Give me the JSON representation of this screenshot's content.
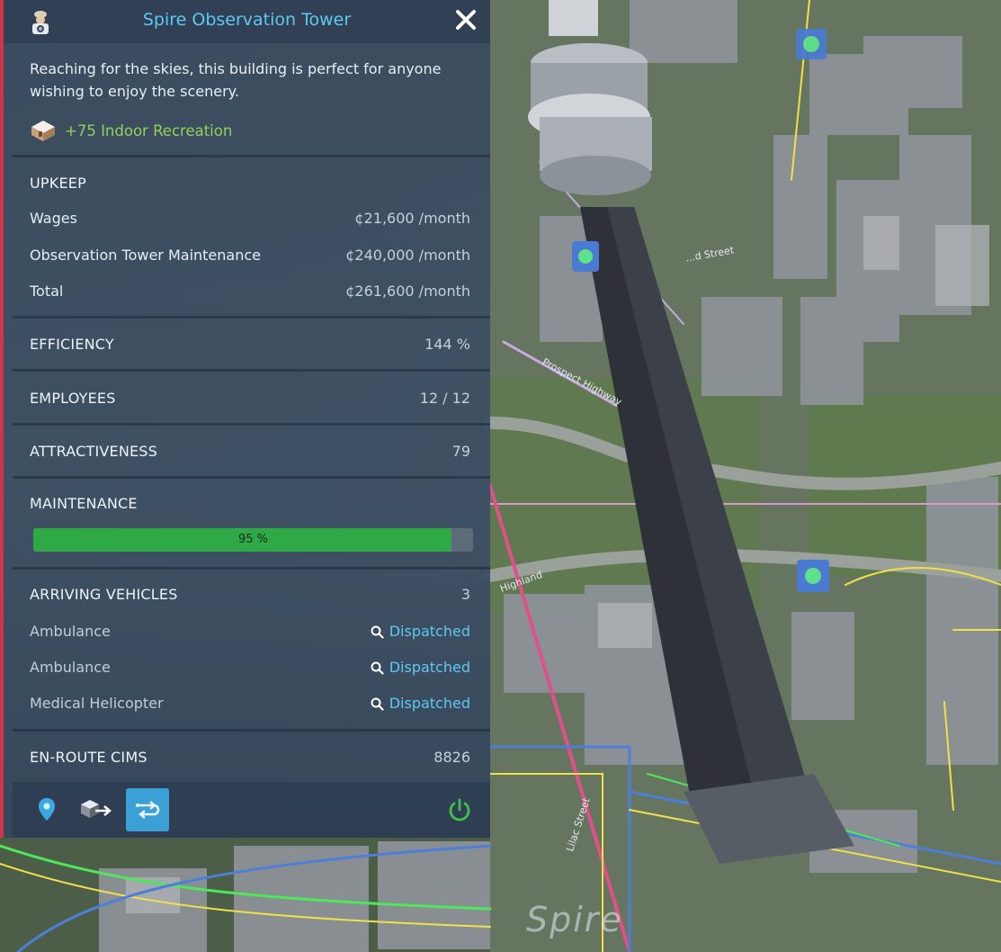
{
  "panel": {
    "title": "Spire Observation Tower",
    "description": "Reaching for the skies, this building is perfect for anyone wishing to enjoy the scenery.",
    "recreation": "+75 Indoor Recreation",
    "upkeep": {
      "header": "UPKEEP",
      "rows": [
        {
          "label": "Wages",
          "value": "¢21,600 /month"
        },
        {
          "label": "Observation Tower Maintenance",
          "value": "¢240,000 /month"
        },
        {
          "label": "Total",
          "value": "¢261,600 /month"
        }
      ]
    },
    "efficiency": {
      "label": "EFFICIENCY",
      "value": "144 %"
    },
    "employees": {
      "label": "EMPLOYEES",
      "value": "12 / 12"
    },
    "attractiveness": {
      "label": "ATTRACTIVENESS",
      "value": "79"
    },
    "maintenance": {
      "label": "MAINTENANCE",
      "value_label": "95 %",
      "fraction": 0.95
    },
    "arriving": {
      "label": "ARRIVING VEHICLES",
      "count": "3",
      "vehicles": [
        {
          "name": "Ambulance",
          "status": "Dispatched"
        },
        {
          "name": "Ambulance",
          "status": "Dispatched"
        },
        {
          "name": "Medical Helicopter",
          "status": "Dispatched"
        }
      ]
    },
    "enroute": {
      "label": "EN-ROUTE CIMS",
      "value": "8826"
    },
    "footer": {
      "icons": [
        "location-pin-icon",
        "relocate-building-icon",
        "route-toggle-icon",
        "power-icon"
      ],
      "active_icon": "route-toggle-icon"
    }
  },
  "map": {
    "big_label": "Spire",
    "street_labels": [
      "Lilac Street",
      "Highland",
      "Prospect Highway",
      "...d Street"
    ]
  },
  "colors": {
    "title": "#5fc8f2",
    "recreation": "#8fd15a",
    "bar_fill": "#2fa846",
    "link": "#5fc8f2",
    "active_button": "#3aa0d6",
    "power": "#3fbf4e",
    "left_border": "#c8384a"
  }
}
